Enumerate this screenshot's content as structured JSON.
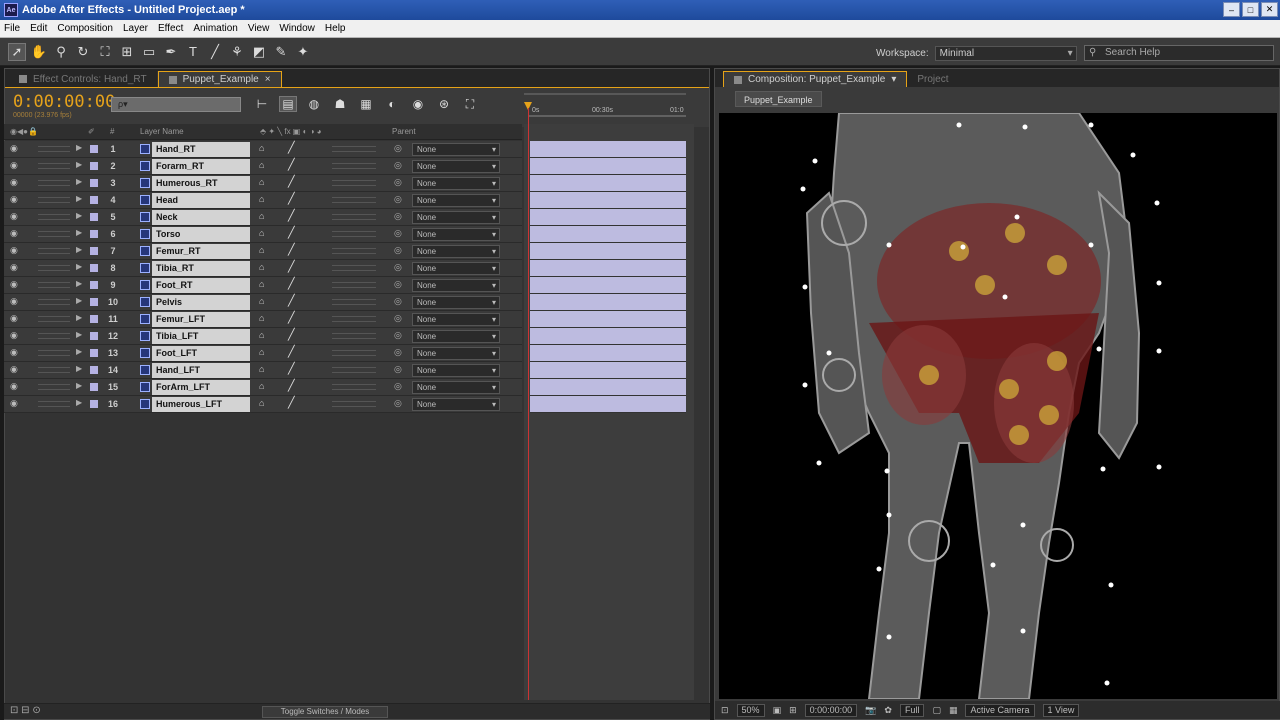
{
  "window": {
    "title": "Adobe After Effects - Untitled Project.aep *",
    "icon": "Ae"
  },
  "menu": [
    "File",
    "Edit",
    "Composition",
    "Layer",
    "Effect",
    "Animation",
    "View",
    "Window",
    "Help"
  ],
  "workspace": {
    "label": "Workspace:",
    "value": "Minimal"
  },
  "search_help": "Search Help",
  "left_tabs": [
    {
      "label": "Effect Controls: Hand_RT"
    },
    {
      "label": "Puppet_Example"
    }
  ],
  "timeline": {
    "timecode": "0:00:00:00",
    "fps": "00000 (23.976 fps)",
    "search_placeholder": "ρ▾",
    "ruler": {
      "start": "0s",
      "mid": "00:30s",
      "end": "01:0"
    },
    "columns": {
      "layer_name": "Layer Name",
      "parent": "Parent",
      "hash": "#"
    },
    "layers": [
      {
        "num": "1",
        "name": "Hand_RT",
        "parent": "None"
      },
      {
        "num": "2",
        "name": "Forarm_RT",
        "parent": "None"
      },
      {
        "num": "3",
        "name": "Humerous_RT",
        "parent": "None"
      },
      {
        "num": "4",
        "name": "Head",
        "parent": "None"
      },
      {
        "num": "5",
        "name": "Neck",
        "parent": "None"
      },
      {
        "num": "6",
        "name": "Torso",
        "parent": "None"
      },
      {
        "num": "7",
        "name": "Femur_RT",
        "parent": "None"
      },
      {
        "num": "8",
        "name": "Tibia_RT",
        "parent": "None"
      },
      {
        "num": "9",
        "name": "Foot_RT",
        "parent": "None"
      },
      {
        "num": "10",
        "name": "Pelvis",
        "parent": "None"
      },
      {
        "num": "11",
        "name": "Femur_LFT",
        "parent": "None"
      },
      {
        "num": "12",
        "name": "Tibia_LFT",
        "parent": "None"
      },
      {
        "num": "13",
        "name": "Foot_LFT",
        "parent": "None"
      },
      {
        "num": "14",
        "name": "Hand_LFT",
        "parent": "None"
      },
      {
        "num": "15",
        "name": "ForArm_LFT",
        "parent": "None"
      },
      {
        "num": "16",
        "name": "Humerous_LFT",
        "parent": "None"
      }
    ],
    "toggle_label": "Toggle Switches / Modes"
  },
  "right_tabs": [
    {
      "label": "Composition: Puppet_Example"
    },
    {
      "label": "Project"
    }
  ],
  "comp_subtab": "Puppet_Example",
  "viewer_bottom": {
    "zoom": "50%",
    "timecode": "0:00:00:00",
    "resolution": "Full",
    "camera": "Active Camera",
    "views": "1 View"
  }
}
